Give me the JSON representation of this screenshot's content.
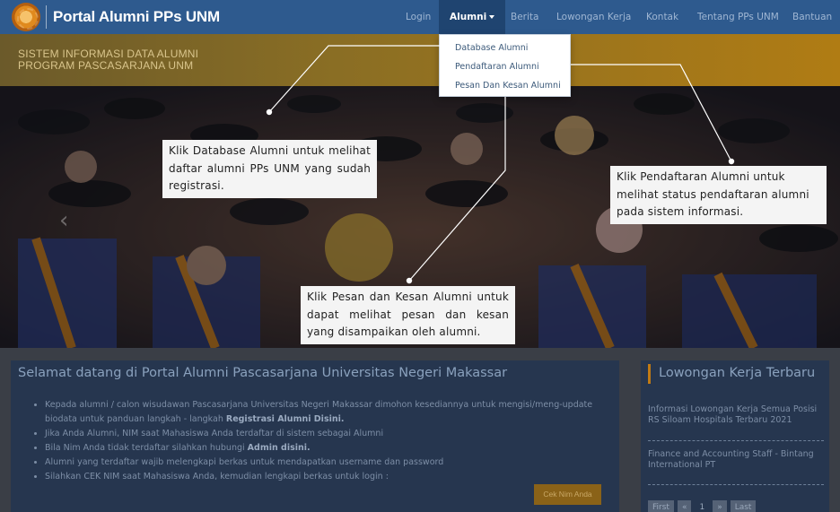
{
  "brand": {
    "name": "Portal Alumni PPs UNM",
    "logo_icon": "unm-logo-icon"
  },
  "nav": {
    "items": [
      {
        "label": "Login"
      },
      {
        "label": "Alumni"
      },
      {
        "label": "Berita"
      },
      {
        "label": "Lowongan Kerja"
      },
      {
        "label": "Kontak"
      },
      {
        "label": "Tentang PPs UNM"
      },
      {
        "label": "Bantuan"
      }
    ],
    "active": "Alumni"
  },
  "banner": {
    "line1": "SISTEM INFORMASI DATA ALUMNI",
    "line2": "PROGRAM PASCASARJANA UNM"
  },
  "dropdown": {
    "items": [
      {
        "label": "Database Alumni"
      },
      {
        "label": "Pendaftaran Alumni"
      },
      {
        "label": "Pesan Dan Kesan Alumni"
      }
    ]
  },
  "callouts": {
    "database": "Klik Database Alumni untuk melihat daftar alumni PPs UNM yang sudah registrasi.",
    "pendaftaran": "Klik Pendaftaran Alumni untuk melihat status pendaftaran alumni pada sistem informasi.",
    "pesan": "Klik Pesan dan Kesan Alumni untuk dapat melihat pesan dan kesan yang disampaikan oleh alumni."
  },
  "welcome": {
    "title": "Selamat datang di Portal Alumni Pascasarjana Universitas Negeri Makassar",
    "items": [
      {
        "text": "Kepada alumni / calon wisudawan Pascasarjana Universitas Negeri Makassar dimohon kesediannya untuk mengisi/meng-update biodata untuk panduan langkah - langkah ",
        "bold": "Registrasi Alumni Disini."
      },
      {
        "text": "Jika Anda Alumni, NIM saat Mahasiswa Anda terdaftar di sistem sebagai Alumni",
        "bold": ""
      },
      {
        "text": "Bila Nim Anda tidak terdaftar silahkan hubungi ",
        "bold": "Admin disini."
      },
      {
        "text": "Alumni yang terdaftar wajib melengkapi berkas untuk mendapatkan username dan password",
        "bold": ""
      },
      {
        "text": "Silahkan CEK NIM saat Mahasiswa Anda, kemudian lengkapi berkas untuk login :",
        "bold": ""
      }
    ],
    "button": "Cek Nim Anda"
  },
  "sidebar": {
    "title": "Lowongan Kerja Terbaru",
    "jobs": [
      {
        "title": "Informasi Lowongan Kerja Semua Posisi RS Siloam Hospitals Terbaru 2021"
      },
      {
        "title": "Finance and Accounting Staff - Bintang International PT"
      }
    ],
    "pager": [
      "First",
      "«",
      "1",
      "»",
      "Last"
    ]
  },
  "colors": {
    "navbar": "#2e5a8e",
    "accent": "#c07a14",
    "panel": "#26364f"
  }
}
